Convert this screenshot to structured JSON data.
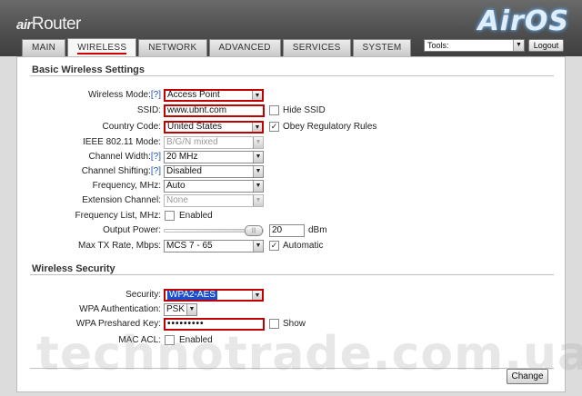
{
  "header": {
    "brand_prefix": "air",
    "brand_suffix": "Router",
    "logo_text": "AirOS"
  },
  "tabs": [
    {
      "label": "MAIN"
    },
    {
      "label": "WIRELESS"
    },
    {
      "label": "NETWORK"
    },
    {
      "label": "ADVANCED"
    },
    {
      "label": "SERVICES"
    },
    {
      "label": "SYSTEM"
    }
  ],
  "tools": {
    "value": "Tools:"
  },
  "logout_label": "Logout",
  "basic": {
    "title": "Basic Wireless Settings",
    "wireless_mode": {
      "label": "Wireless Mode:",
      "help": "[?]",
      "value": "Access Point"
    },
    "ssid": {
      "label": "SSID:",
      "value": "www.ubnt.com",
      "hide_label": "Hide SSID"
    },
    "country": {
      "label": "Country Code:",
      "value": "United States",
      "obey_label": "Obey Regulatory Rules"
    },
    "ieee_mode": {
      "label": "IEEE 802.11 Mode:",
      "value": "B/G/N mixed"
    },
    "channel_width": {
      "label": "Channel Width:",
      "help": "[?]",
      "value": "20 MHz"
    },
    "channel_shifting": {
      "label": "Channel Shifting:",
      "help": "[?]",
      "value": "Disabled"
    },
    "frequency": {
      "label": "Frequency, MHz:",
      "value": "Auto"
    },
    "extension_channel": {
      "label": "Extension Channel:",
      "value": "None"
    },
    "frequency_list": {
      "label": "Frequency List, MHz:",
      "enabled_label": "Enabled"
    },
    "output_power": {
      "label": "Output Power:",
      "value": "20",
      "unit": "dBm"
    },
    "max_tx_rate": {
      "label": "Max TX Rate, Mbps:",
      "value": "MCS 7 - 65",
      "auto_label": "Automatic"
    }
  },
  "security": {
    "title": "Wireless Security",
    "security": {
      "label": "Security:",
      "value": "WPA2-AES"
    },
    "wpa_auth": {
      "label": "WPA Authentication:",
      "value": "PSK"
    },
    "psk": {
      "label": "WPA Preshared Key:",
      "value": "•••••••••",
      "show_label": "Show"
    },
    "mac_acl": {
      "label": "MAC ACL:",
      "enabled_label": "Enabled"
    }
  },
  "change_label": "Change",
  "watermark": "technotrade.com.ua"
}
